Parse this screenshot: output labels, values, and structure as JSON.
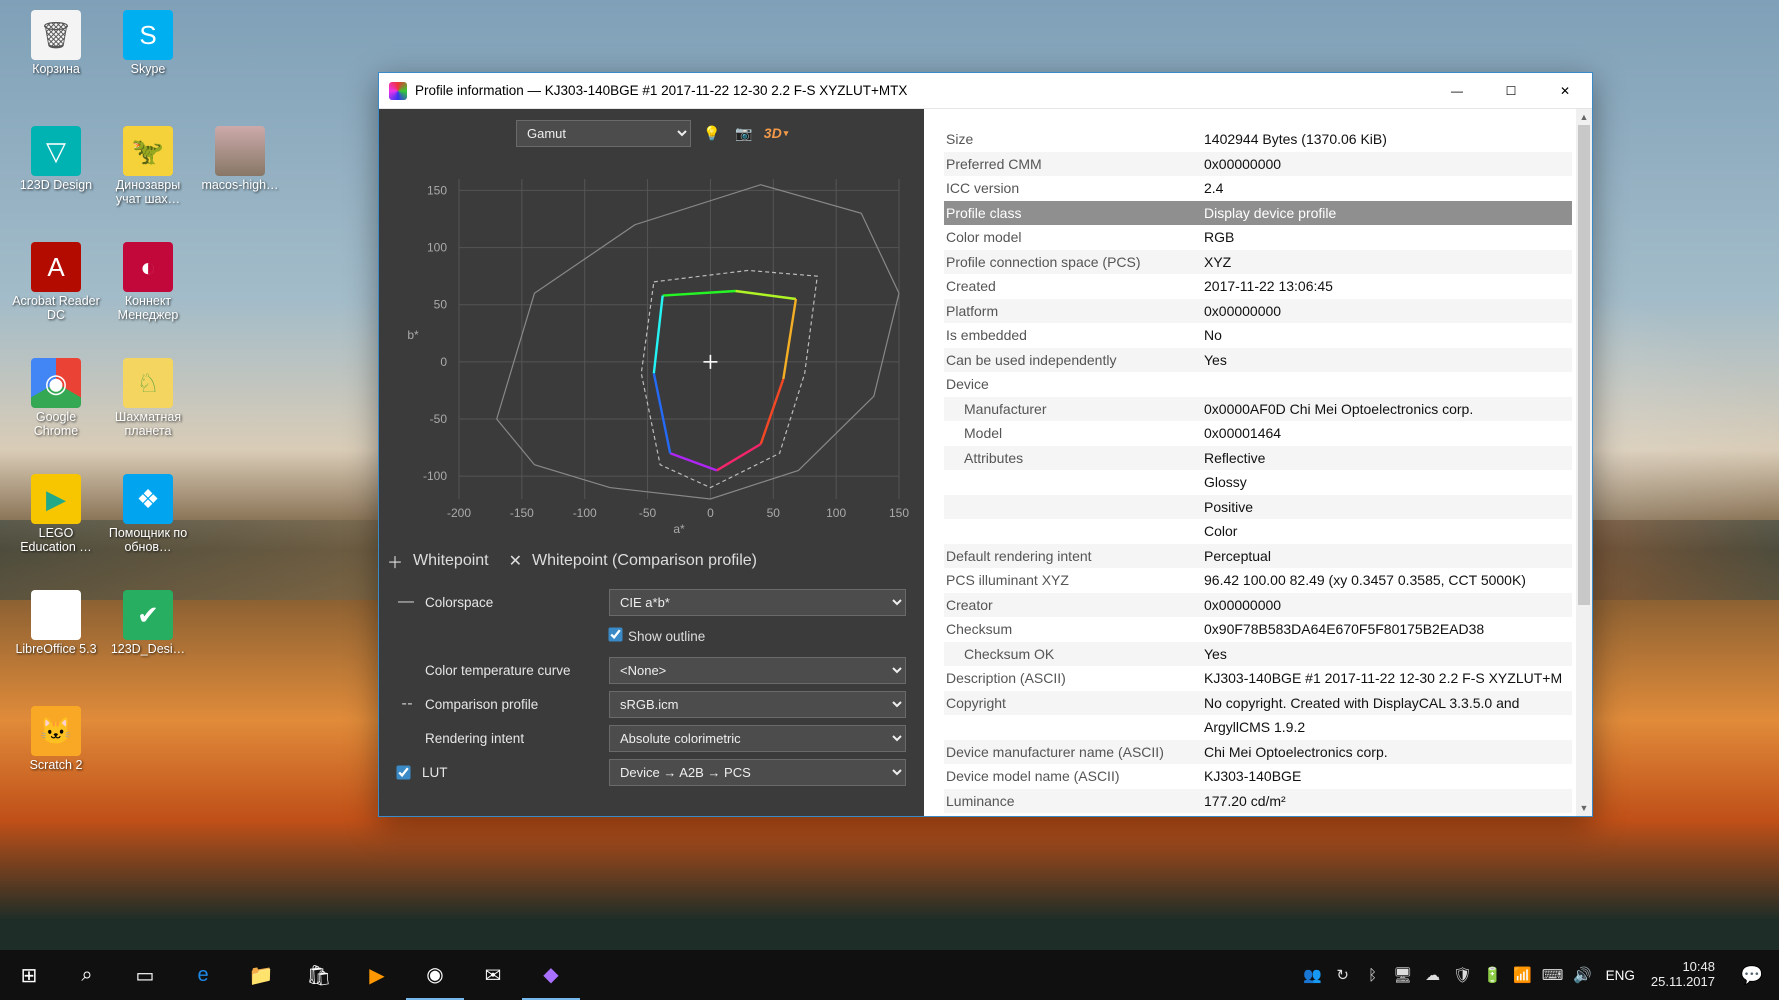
{
  "desktop": {
    "icons": [
      {
        "name": "recycle-bin",
        "label": "Корзина",
        "glyph": "🗑",
        "bg": "#f4f4f4",
        "fg": "#555"
      },
      {
        "name": "skype",
        "label": "Skype",
        "glyph": "S",
        "bg": "#00aff0"
      },
      {
        "name": "empty-0",
        "label": "",
        "glyph": "",
        "bg": "transparent"
      },
      {
        "name": "123d-design",
        "label": "123D Design",
        "glyph": "▽",
        "bg": "#00b3b3"
      },
      {
        "name": "dino-chess",
        "label": "Динозавры учат шах…",
        "glyph": "🦖",
        "bg": "#f6d23a",
        "fg": "#333"
      },
      {
        "name": "macos-high",
        "label": "macos-high…",
        "glyph": "",
        "bg": "linear-gradient(#caa,#876)"
      },
      {
        "name": "acrobat",
        "label": "Acrobat Reader DC",
        "glyph": "A",
        "bg": "#b30b00"
      },
      {
        "name": "connect-mgr",
        "label": "Коннект Менеджер",
        "glyph": "◐",
        "bg": "#c2073a"
      },
      {
        "name": "empty-1",
        "label": "",
        "glyph": "",
        "bg": "transparent"
      },
      {
        "name": "chrome",
        "label": "Google Chrome",
        "glyph": "◉",
        "bg": "conic-gradient(#ea4335 0 120deg,#34a853 120deg 240deg,#4285f4 240deg 360deg)"
      },
      {
        "name": "chess-planet",
        "label": "Шахматная планета",
        "glyph": "♘",
        "bg": "#f4d560",
        "fg": "#7a4"
      },
      {
        "name": "empty-2",
        "label": "",
        "glyph": "",
        "bg": "transparent"
      },
      {
        "name": "lego-education",
        "label": "LEGO Education …",
        "glyph": "▶",
        "bg": "#f7c600",
        "fg": "#2a8"
      },
      {
        "name": "update-helper",
        "label": "Помощник по обнов…",
        "glyph": "❖",
        "bg": "#00a4ef"
      },
      {
        "name": "empty-3",
        "label": "",
        "glyph": "",
        "bg": "transparent"
      },
      {
        "name": "libreoffice",
        "label": "LibreOffice 5.3",
        "glyph": "",
        "bg": "#fff",
        "fg": "#333"
      },
      {
        "name": "123d-design-file",
        "label": "123D_Desi…",
        "glyph": "✔",
        "bg": "#27ae60"
      },
      {
        "name": "empty-4",
        "label": "",
        "glyph": "",
        "bg": "transparent"
      },
      {
        "name": "scratch",
        "label": "Scratch 2",
        "glyph": "🐱",
        "bg": "#f9a825"
      }
    ]
  },
  "window": {
    "title": "Profile information — KJ303-140BGE #1 2017-11-22 12-30 2.2 F-S XYZLUT+MTX",
    "toolbar": {
      "mode": "Gamut",
      "btn_3d": "3D"
    },
    "toggles": {
      "whitepoint": "Whitepoint",
      "whitepoint_comparison": "Whitepoint (Comparison profile)"
    },
    "form": {
      "colorspace_label": "Colorspace",
      "colorspace_value": "CIE a*b*",
      "show_outline": "Show outline",
      "ctc_label": "Color temperature curve",
      "ctc_value": "<None>",
      "comparison_label": "Comparison profile",
      "comparison_value": "sRGB.icm",
      "intent_label": "Rendering intent",
      "intent_value": "Absolute colorimetric",
      "lut_label": "LUT",
      "lut_value": "Device → A2B → PCS"
    },
    "chart_data": {
      "type": "gamut",
      "xlabel": "a*",
      "ylabel": "b*",
      "x_ticks": [
        -200,
        -150,
        -100,
        -50,
        0,
        50,
        100,
        150
      ],
      "y_ticks": [
        -100,
        -50,
        0,
        50,
        100,
        150
      ],
      "spectral_locus": [
        [
          -170,
          -50
        ],
        [
          -140,
          60
        ],
        [
          -60,
          120
        ],
        [
          40,
          155
        ],
        [
          120,
          130
        ],
        [
          150,
          60
        ],
        [
          130,
          -30
        ],
        [
          70,
          -95
        ],
        [
          0,
          -120
        ],
        [
          -80,
          -110
        ],
        [
          -140,
          -90
        ],
        [
          -170,
          -50
        ]
      ],
      "comparison_srgb": [
        [
          -45,
          70
        ],
        [
          30,
          80
        ],
        [
          85,
          75
        ],
        [
          75,
          -10
        ],
        [
          55,
          -80
        ],
        [
          0,
          -110
        ],
        [
          -40,
          -90
        ],
        [
          -55,
          -10
        ],
        [
          -45,
          70
        ]
      ],
      "device_gamut": [
        [
          -38,
          58
        ],
        [
          20,
          62
        ],
        [
          68,
          55
        ],
        [
          58,
          -15
        ],
        [
          40,
          -72
        ],
        [
          5,
          -95
        ],
        [
          -32,
          -80
        ],
        [
          -45,
          -10
        ],
        [
          -38,
          58
        ]
      ],
      "whitepoint": [
        0,
        0
      ]
    }
  },
  "info": [
    {
      "k": "Size",
      "v": "1402944 Bytes (1370.06 KiB)"
    },
    {
      "k": "Preferred CMM",
      "v": "0x00000000"
    },
    {
      "k": "ICC version",
      "v": "2.4"
    },
    {
      "k": "Profile class",
      "v": "Display device profile",
      "sel": true
    },
    {
      "k": "Color model",
      "v": "RGB"
    },
    {
      "k": "Profile connection space (PCS)",
      "v": "XYZ"
    },
    {
      "k": "Created",
      "v": "2017-11-22 13:06:45"
    },
    {
      "k": "Platform",
      "v": "0x00000000"
    },
    {
      "k": "Is embedded",
      "v": "No"
    },
    {
      "k": "Can be used independently",
      "v": "Yes"
    },
    {
      "k": "Device",
      "v": ""
    },
    {
      "k": "Manufacturer",
      "v": "0x0000AF0D Chi Mei Optoelectronics corp.",
      "ind": true
    },
    {
      "k": "Model",
      "v": "0x00001464",
      "ind": true
    },
    {
      "k": "Attributes",
      "v": "Reflective",
      "ind": true
    },
    {
      "k": "",
      "v": "Glossy"
    },
    {
      "k": "",
      "v": "Positive"
    },
    {
      "k": "",
      "v": "Color"
    },
    {
      "k": "Default rendering intent",
      "v": "Perceptual"
    },
    {
      "k": "PCS illuminant XYZ",
      "v": "96.42 100.00  82.49 (xy 0.3457 0.3585, CCT 5000K)"
    },
    {
      "k": "Creator",
      "v": "0x00000000"
    },
    {
      "k": "Checksum",
      "v": "0x90F78B583DA64E670F5F80175B2EAD38"
    },
    {
      "k": "Checksum OK",
      "v": "Yes",
      "ind": true
    },
    {
      "k": "Description (ASCII)",
      "v": "KJ303-140BGE #1 2017-11-22 12-30 2.2 F-S XYZLUT+M"
    },
    {
      "k": "Copyright",
      "v": "No copyright. Created with DisplayCAL 3.3.5.0 and"
    },
    {
      "k": "",
      "v": "ArgyllCMS 1.9.2"
    },
    {
      "k": "Device manufacturer name (ASCII)",
      "v": "Chi Mei Optoelectronics corp."
    },
    {
      "k": "Device model name (ASCII)",
      "v": "KJ303-140BGE"
    },
    {
      "k": "Luminance",
      "v": "177.20 cd/m²"
    }
  ],
  "taskbar": {
    "pinned": [
      {
        "name": "start",
        "glyph": "⊞"
      },
      {
        "name": "search",
        "glyph": "⌕"
      },
      {
        "name": "taskview",
        "glyph": "▭"
      },
      {
        "name": "edge",
        "glyph": "e",
        "color": "#1e88e5"
      },
      {
        "name": "explorer",
        "glyph": "📁",
        "color": "#f3c14b"
      },
      {
        "name": "store",
        "glyph": "🛍"
      },
      {
        "name": "movies",
        "glyph": "▶",
        "color": "#ff9800"
      },
      {
        "name": "chrome",
        "glyph": "◉",
        "running": true
      },
      {
        "name": "mail",
        "glyph": "✉"
      },
      {
        "name": "displaycal",
        "glyph": "◆",
        "running": true,
        "color": "#a970ff"
      }
    ],
    "tray": [
      "people",
      "sync",
      "bluetooth",
      "monitor",
      "onedrive",
      "defender",
      "power",
      "wifi",
      "keyboard",
      "volume"
    ],
    "lang": "ENG",
    "time": "10:48",
    "date": "25.11.2017"
  }
}
